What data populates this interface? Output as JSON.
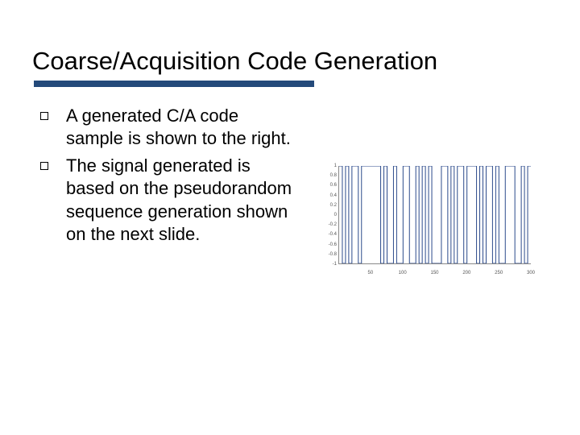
{
  "title": "Coarse/Acquisition Code Generation",
  "bullets": [
    "A generated C/A code sample is shown to the right.",
    "The signal generated is based on the pseudorandom sequence generation shown on the next slide."
  ],
  "chart_data": {
    "type": "line",
    "title": "",
    "xlabel": "",
    "ylabel": "",
    "xlim": [
      0,
      300
    ],
    "ylim": [
      -1,
      1
    ],
    "x_ticks": [
      50,
      100,
      150,
      200,
      250,
      300
    ],
    "y_ticks": [
      1,
      0.8,
      0.6,
      0.4,
      0.2,
      0,
      -0.2,
      -0.4,
      -0.6,
      -0.8,
      -1
    ],
    "signal_levels": [
      1,
      -1,
      1,
      -1,
      1,
      1,
      -1,
      1,
      1,
      1,
      1,
      1,
      1,
      -1,
      1,
      -1,
      -1,
      1,
      -1,
      -1,
      1,
      1,
      -1,
      -1,
      1,
      -1,
      1,
      -1,
      1,
      -1,
      -1,
      -1,
      1,
      1,
      -1,
      1,
      -1,
      1,
      1,
      -1,
      1,
      1,
      1,
      -1,
      1,
      -1,
      1,
      1,
      -1,
      1,
      -1,
      -1,
      1,
      1,
      1,
      -1,
      -1,
      1,
      -1,
      1
    ]
  }
}
